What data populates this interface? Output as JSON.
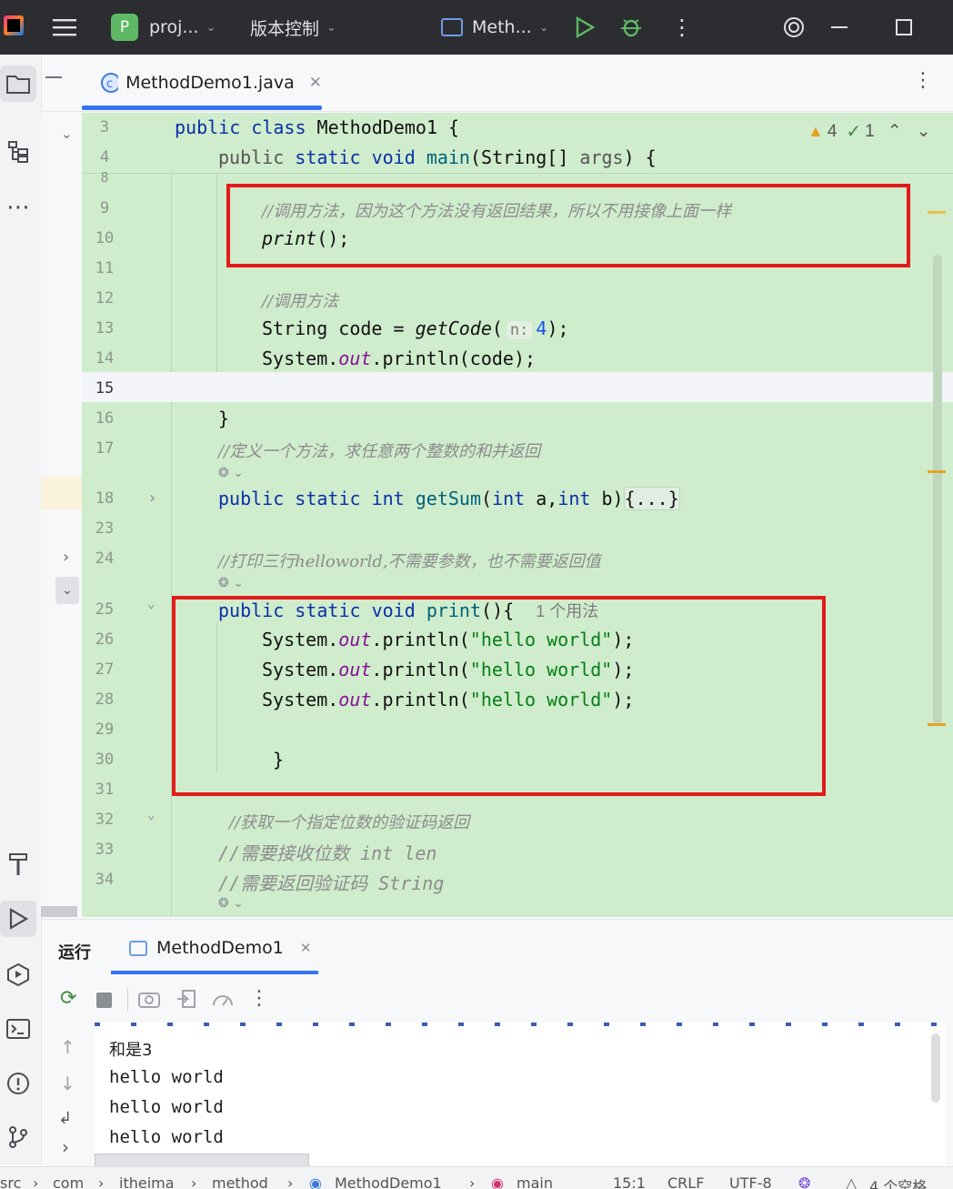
{
  "titlebar": {
    "project_letter": "P",
    "project_name": "proj...",
    "vcs_label": "版本控制",
    "run_config": "Meth..."
  },
  "tab": {
    "filename": "MethodDemo1.java"
  },
  "inspections": {
    "warnings": "4",
    "checks": "1"
  },
  "code_lines": [
    {
      "num": "3"
    },
    {
      "num": "4"
    },
    {
      "num": "8"
    },
    {
      "num": "9"
    },
    {
      "num": "10"
    },
    {
      "num": "11"
    },
    {
      "num": "12"
    },
    {
      "num": "13"
    },
    {
      "num": "14"
    },
    {
      "num": "15"
    },
    {
      "num": "16"
    },
    {
      "num": "17"
    },
    {
      "num": "18"
    },
    {
      "num": "23"
    },
    {
      "num": "24"
    },
    {
      "num": "25"
    },
    {
      "num": "26"
    },
    {
      "num": "27"
    },
    {
      "num": "28"
    },
    {
      "num": "29"
    },
    {
      "num": "30"
    },
    {
      "num": "31"
    },
    {
      "num": "32"
    },
    {
      "num": "33"
    },
    {
      "num": "34"
    }
  ],
  "code": {
    "l3": {
      "k1": "public",
      "k2": "class",
      "rest": " MethodDemo1 {"
    },
    "l4": {
      "k1": "public",
      "k2": "static",
      "k3": "void",
      "fn": "main",
      "rest": "(String[] ",
      "arg": "args",
      "end": ") {"
    },
    "l9_comment": "//调用方法，因为这个方法没有返回结果，所以不用接像上面一样",
    "l10": {
      "call": "print",
      "rest": "();"
    },
    "l12_comment": "//调用方法",
    "l13": {
      "a": "String code = ",
      "call": "getCode",
      "b": "(",
      "hint": "n:",
      "num": "4",
      "c": ");"
    },
    "l14": {
      "a": "System.",
      "field": "out",
      "b": ".println(code);"
    },
    "l16": "}",
    "l17_comment": "//定义一个方法，求任意两个整数的和并返回",
    "l18": {
      "k1": "public",
      "k2": "static",
      "k3": "int",
      "fn": "getSum",
      "a": "(",
      "k4": "int",
      "b": " a,",
      "k5": "int",
      "c": " b)",
      "fold": "{...}"
    },
    "l24_comment": "//打印三行helloworld,不需要参数，也不需要返回值",
    "l25": {
      "k1": "public",
      "k2": "static",
      "k3": "void",
      "fn": "print",
      "rest": "(){",
      "usage": "1 个用法"
    },
    "l26": {
      "a": "System.",
      "field": "out",
      "b": ".println(",
      "str": "\"hello world\"",
      "c": ");"
    },
    "l30": "}",
    "l32_comment": "//获取一个指定位数的验证码返回",
    "l33_comment": "//需要接收位数 int len",
    "l34_comment": "//需要返回验证码 String"
  },
  "run": {
    "tab_label": "运行",
    "config_tab": "MethodDemo1",
    "output": [
      "和是3",
      "hello world",
      "hello world",
      "hello world"
    ]
  },
  "statusbar": {
    "breadcrumbs": [
      "src",
      "com",
      "itheima",
      "method",
      "MethodDemo1",
      "main"
    ],
    "position": "15:1",
    "line_sep": "CRLF",
    "encoding": "UTF-8",
    "indent": "4 个空格"
  },
  "colors": {
    "editor_bg": "#cfeccc",
    "highlight": "#e11b1b",
    "titlebar": "#2b2d30"
  }
}
